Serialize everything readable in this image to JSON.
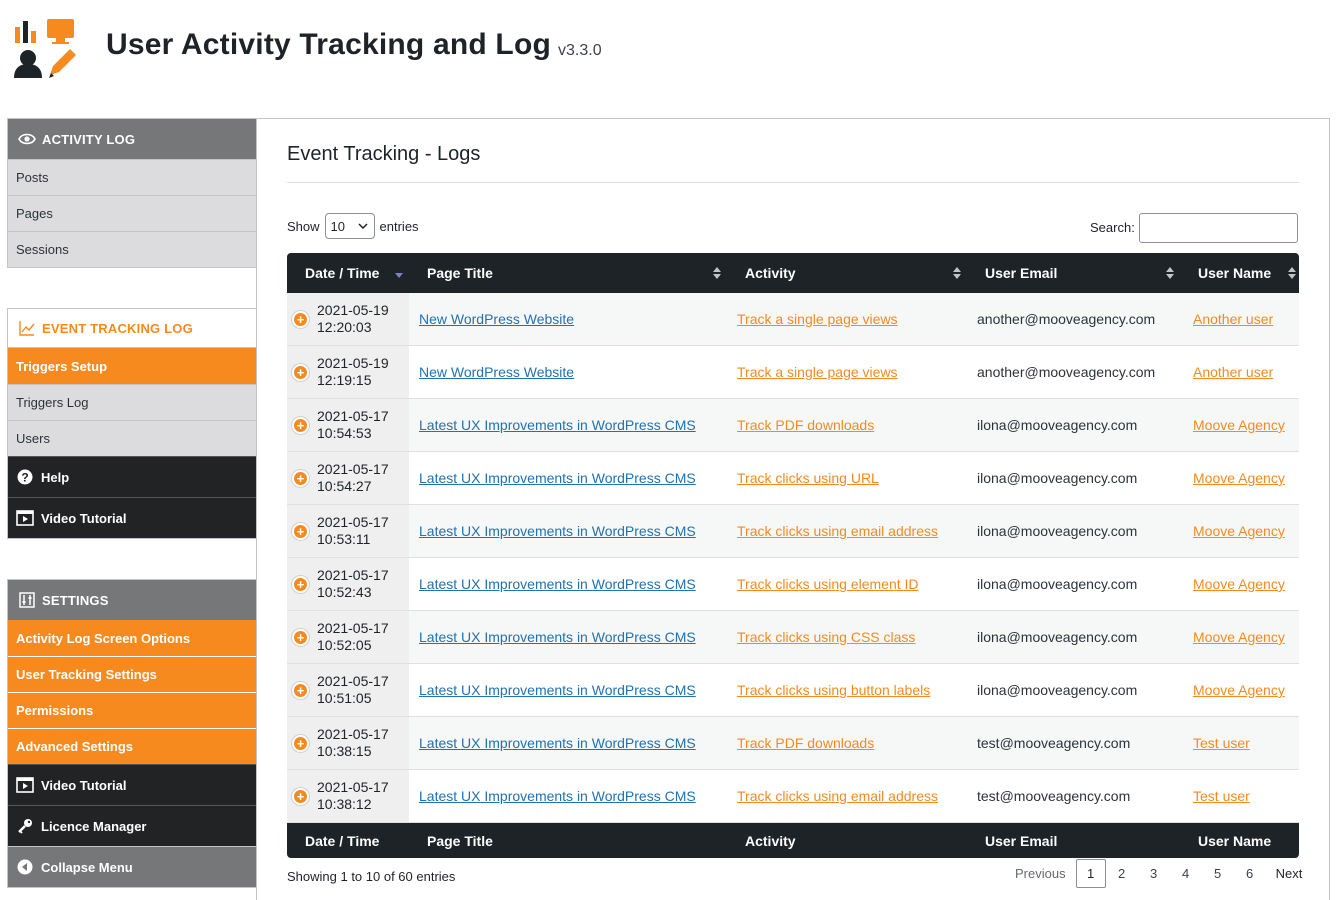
{
  "header": {
    "title": "User Activity Tracking and Log",
    "version": "v3.3.0"
  },
  "sidebar": {
    "activity_log": {
      "heading": "ACTIVITY LOG",
      "items": [
        "Posts",
        "Pages",
        "Sessions"
      ]
    },
    "event_tracking": {
      "heading": "EVENT TRACKING LOG",
      "items": [
        "Triggers Setup",
        "Triggers Log",
        "Users"
      ],
      "help": "Help",
      "video": "Video Tutorial"
    },
    "settings": {
      "heading": "SETTINGS",
      "items": [
        "Activity Log Screen Options",
        "User Tracking Settings",
        "Permissions",
        "Advanced Settings"
      ],
      "video": "Video Tutorial",
      "licence": "Licence Manager",
      "collapse": "Collapse Menu"
    }
  },
  "main": {
    "title": "Event Tracking - Logs",
    "show_label": "Show",
    "entries_label": "entries",
    "page_size": "10",
    "search_label": "Search:",
    "columns": [
      "Date / Time",
      "Page Title",
      "Activity",
      "User Email",
      "User Name"
    ],
    "rows": [
      {
        "date": "2021-05-19",
        "time": "12:20:03",
        "page": "New WordPress Website",
        "activity": "Track a single page views",
        "email": "another@mooveagency.com",
        "user": "Another user"
      },
      {
        "date": "2021-05-19",
        "time": "12:19:15",
        "page": "New WordPress Website",
        "activity": "Track a single page views",
        "email": "another@mooveagency.com",
        "user": "Another user"
      },
      {
        "date": "2021-05-17",
        "time": "10:54:53",
        "page": "Latest UX Improvements in WordPress CMS",
        "activity": "Track PDF downloads",
        "email": "ilona@mooveagency.com",
        "user": "Moove Agency"
      },
      {
        "date": "2021-05-17",
        "time": "10:54:27",
        "page": "Latest UX Improvements in WordPress CMS",
        "activity": "Track clicks using URL",
        "email": "ilona@mooveagency.com",
        "user": "Moove Agency"
      },
      {
        "date": "2021-05-17",
        "time": "10:53:11",
        "page": "Latest UX Improvements in WordPress CMS",
        "activity": "Track clicks using email address",
        "email": "ilona@mooveagency.com",
        "user": "Moove Agency"
      },
      {
        "date": "2021-05-17",
        "time": "10:52:43",
        "page": "Latest UX Improvements in WordPress CMS",
        "activity": "Track clicks using element ID",
        "email": "ilona@mooveagency.com",
        "user": "Moove Agency"
      },
      {
        "date": "2021-05-17",
        "time": "10:52:05",
        "page": "Latest UX Improvements in WordPress CMS",
        "activity": "Track clicks using CSS class",
        "email": "ilona@mooveagency.com",
        "user": "Moove Agency"
      },
      {
        "date": "2021-05-17",
        "time": "10:51:05",
        "page": "Latest UX Improvements in WordPress CMS",
        "activity": "Track clicks using button labels",
        "email": "ilona@mooveagency.com",
        "user": "Moove Agency"
      },
      {
        "date": "2021-05-17",
        "time": "10:38:15",
        "page": "Latest UX Improvements in WordPress CMS",
        "activity": "Track PDF downloads",
        "email": "test@mooveagency.com",
        "user": "Test user"
      },
      {
        "date": "2021-05-17",
        "time": "10:38:12",
        "page": "Latest UX Improvements in WordPress CMS",
        "activity": "Track clicks using email address",
        "email": "test@mooveagency.com",
        "user": "Test user"
      }
    ],
    "info": "Showing 1 to 10 of 60 entries",
    "pagination": {
      "previous": "Previous",
      "pages": [
        "1",
        "2",
        "3",
        "4",
        "5",
        "6"
      ],
      "current": "1",
      "next": "Next"
    }
  },
  "colors": {
    "accent": "#f68a1f",
    "dark": "#1d2327",
    "link": "#2271b1",
    "grey": "#757779"
  },
  "icons": [
    "logo-icon",
    "eye-icon",
    "chart-icon",
    "help-icon",
    "video-icon",
    "settings-icon",
    "key-icon",
    "collapse-icon",
    "chevron-down-icon",
    "sort-icon",
    "expand-icon"
  ]
}
